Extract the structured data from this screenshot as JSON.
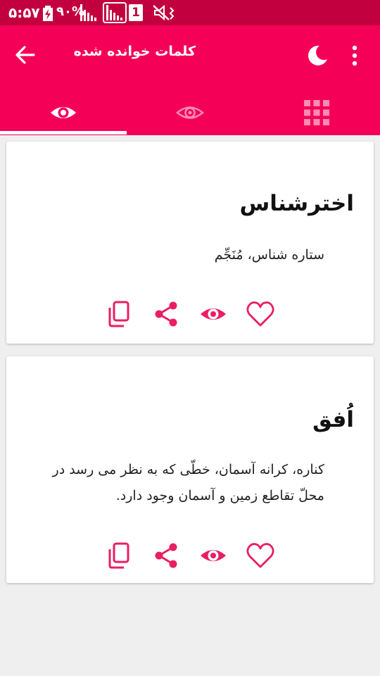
{
  "status_bar": {
    "time": "۵:۵۷",
    "battery": "۹۰%",
    "sim_slot": "1",
    "icons": [
      "battery-charging-icon",
      "signal-icon",
      "signal-icon",
      "sim-icon",
      "mute-icon"
    ]
  },
  "app_bar": {
    "title": "کلمات خوانده شده",
    "icons": [
      "arrow-back-icon",
      "moon-icon",
      "more-vert-icon"
    ]
  },
  "tabs": [
    {
      "icon": "eye-icon",
      "selected": true
    },
    {
      "icon": "eye-outline-icon",
      "selected": false
    },
    {
      "icon": "grid-icon",
      "selected": false
    }
  ],
  "words": [
    {
      "word": "اخترشناس",
      "meaning": "ستاره شناس، مُنَجِّم"
    },
    {
      "word": "اُفق",
      "meaning": "کناره، کرانه آسمان، خطّی که به نظر می رسد در محلّ تقاطع زمین و آسمان وجود دارد."
    }
  ],
  "colors": {
    "status_bar": "#c2003f",
    "primary": "#f50057",
    "background": "#efefef",
    "card": "#ffffff",
    "icon_accent": "#e91e63"
  }
}
